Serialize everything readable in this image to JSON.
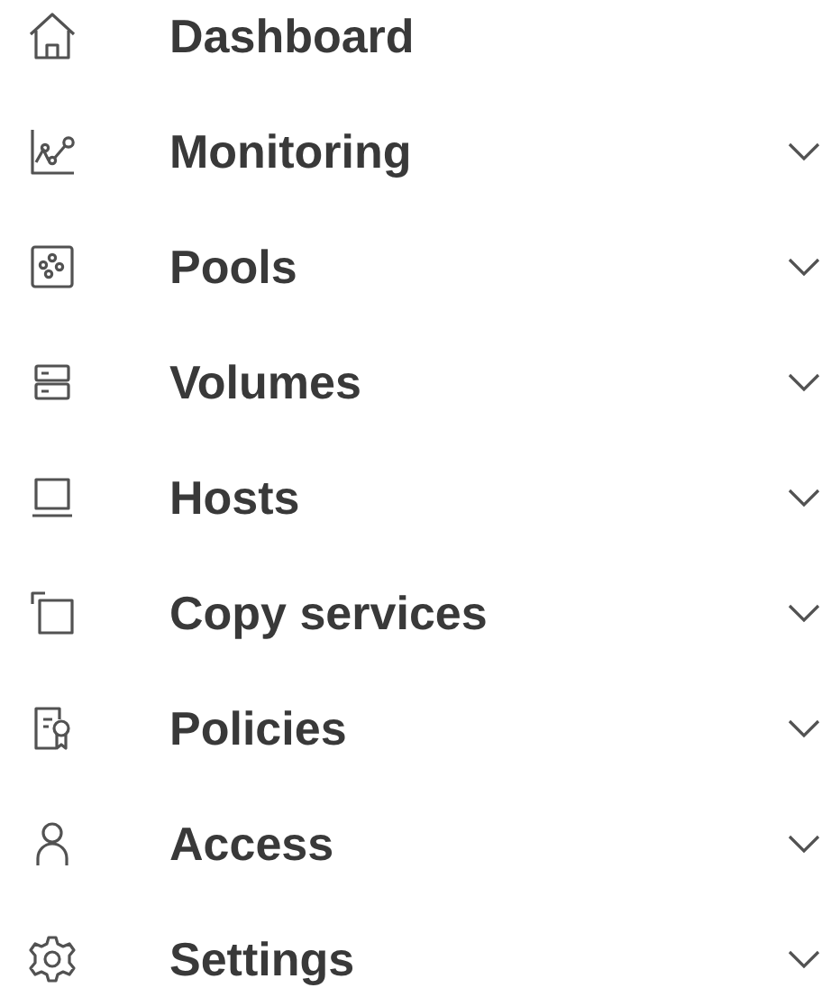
{
  "nav": {
    "items": [
      {
        "label": "Dashboard",
        "has_submenu": false
      },
      {
        "label": "Monitoring",
        "has_submenu": true
      },
      {
        "label": "Pools",
        "has_submenu": true
      },
      {
        "label": "Volumes",
        "has_submenu": true
      },
      {
        "label": "Hosts",
        "has_submenu": true
      },
      {
        "label": "Copy services",
        "has_submenu": true
      },
      {
        "label": "Policies",
        "has_submenu": true
      },
      {
        "label": "Access",
        "has_submenu": true
      },
      {
        "label": "Settings",
        "has_submenu": true
      }
    ]
  }
}
